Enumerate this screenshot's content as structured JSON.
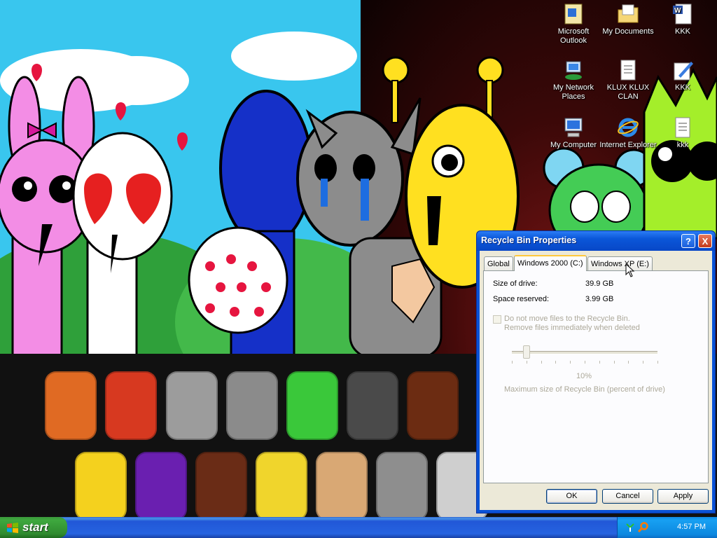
{
  "desktop": {
    "icons": [
      {
        "label": "Microsoft Outlook",
        "icon": "outlook-icon"
      },
      {
        "label": "My Documents",
        "icon": "folder-documents-icon"
      },
      {
        "label": "KKK",
        "icon": "word-document-icon"
      },
      {
        "label": "My Network Places",
        "icon": "network-places-icon"
      },
      {
        "label": "KLUX KLUX CLAN",
        "icon": "text-document-icon"
      },
      {
        "label": "KKK",
        "icon": "paint-document-icon"
      },
      {
        "label": "My Computer",
        "icon": "my-computer-icon"
      },
      {
        "label": "Internet Explorer",
        "icon": "internet-explorer-icon"
      },
      {
        "label": "kkk",
        "icon": "text-document-icon"
      }
    ]
  },
  "dialog": {
    "title": "Recycle Bin Properties",
    "help_btn": "?",
    "close_btn": "X",
    "tabs": [
      {
        "label": "Global",
        "active": false
      },
      {
        "label": "Windows 2000 (C:)",
        "active": true
      },
      {
        "label": "Windows XP (E:)",
        "active": false
      }
    ],
    "size_label": "Size of drive:",
    "size_value": "39.9 GB",
    "reserved_label": "Space reserved:",
    "reserved_value": "3.99 GB",
    "checkbox_line1": "Do not move files to the Recycle Bin.",
    "checkbox_line2": "Remove files immediately when deleted",
    "checkbox_checked": false,
    "slider_value": "10%",
    "slider_fraction": 0.1,
    "slider_caption": "Maximum size of Recycle Bin (percent of drive)",
    "ok": "OK",
    "cancel": "Cancel",
    "apply": "Apply"
  },
  "taskbar": {
    "start_label": "start",
    "clock": "4:57 PM"
  },
  "colors": {
    "xp_blue": "#0a56d8",
    "start_green": "#3ea83e",
    "dialog_face": "#ece9d8",
    "sky": "#39c6ee",
    "dark_red": "#7a1515"
  }
}
